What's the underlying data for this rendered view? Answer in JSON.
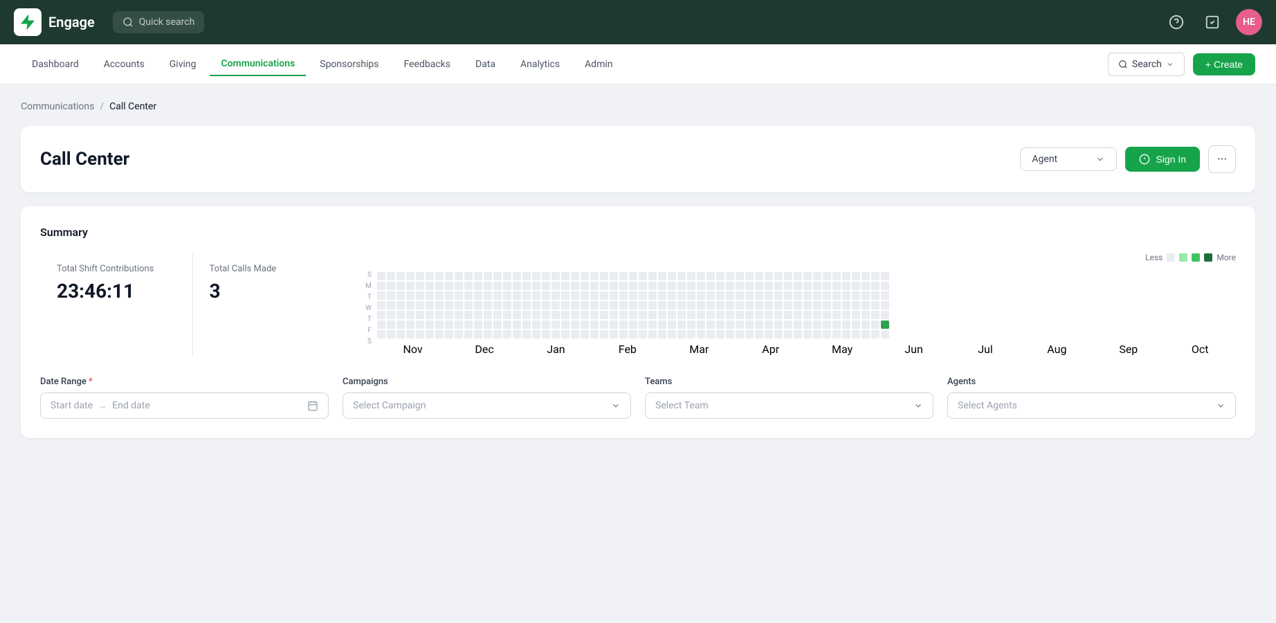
{
  "app": {
    "logo_text": "Engage",
    "search_placeholder": "Quick search",
    "avatar_initials": "HE"
  },
  "topbar": {
    "search_label": "Quick search",
    "help_icon": "help-circle-icon",
    "tasks_icon": "tasks-icon",
    "avatar_initials": "HE"
  },
  "subnav": {
    "items": [
      {
        "id": "dashboard",
        "label": "Dashboard",
        "active": false
      },
      {
        "id": "accounts",
        "label": "Accounts",
        "active": false
      },
      {
        "id": "giving",
        "label": "Giving",
        "active": false
      },
      {
        "id": "communications",
        "label": "Communications",
        "active": true
      },
      {
        "id": "sponsorships",
        "label": "Sponsorships",
        "active": false
      },
      {
        "id": "feedbacks",
        "label": "Feedbacks",
        "active": false
      },
      {
        "id": "data",
        "label": "Data",
        "active": false
      },
      {
        "id": "analytics",
        "label": "Analytics",
        "active": false
      },
      {
        "id": "admin",
        "label": "Admin",
        "active": false
      }
    ],
    "search_label": "Search",
    "create_label": "+ Create"
  },
  "breadcrumb": {
    "parent": "Communications",
    "current": "Call Center"
  },
  "callcenter": {
    "title": "Call Center",
    "agent_label": "Agent",
    "sign_in_label": "Sign In",
    "more_icon": "···"
  },
  "summary": {
    "title": "Summary",
    "total_shift_contributions_label": "Total Shift Contributions",
    "total_shift_contributions_value": "23:46:11",
    "total_calls_made_label": "Total Calls Made",
    "total_calls_made_value": "3",
    "heatmap": {
      "legend_less": "Less",
      "legend_more": "More",
      "months": [
        "Nov",
        "Dec",
        "Jan",
        "Feb",
        "Mar",
        "Apr",
        "May",
        "Jun",
        "Jul",
        "Aug",
        "Sep",
        "Oct"
      ],
      "days": [
        "S",
        "M",
        "T",
        "W",
        "T",
        "F",
        "S"
      ]
    }
  },
  "filters": {
    "date_range": {
      "label": "Date Range",
      "required": true,
      "start_placeholder": "Start date",
      "end_placeholder": "End date"
    },
    "campaigns": {
      "label": "Campaigns",
      "placeholder": "Select Campaign"
    },
    "teams": {
      "label": "Teams",
      "placeholder": "Select Team"
    },
    "agents": {
      "label": "Agents",
      "placeholder": "Select Agents"
    }
  }
}
